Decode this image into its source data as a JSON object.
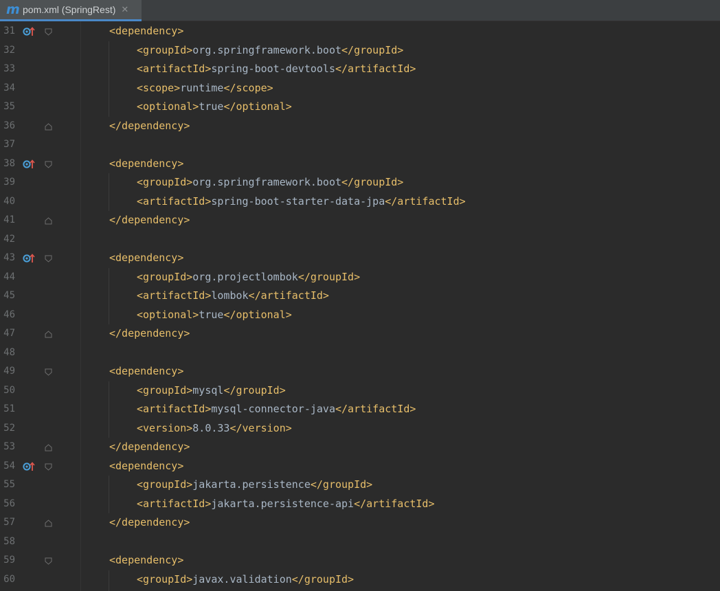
{
  "tab": {
    "icon": "maven-m-icon",
    "icon_glyph": "m",
    "title": "pom.xml (SpringRest)",
    "close_glyph": "✕"
  },
  "lines": [
    {
      "num": "31",
      "indent": 1,
      "open": "<dependency>",
      "content": "",
      "close": "",
      "gutter": true,
      "fold": "start"
    },
    {
      "num": "32",
      "indent": 2,
      "open": "<groupId>",
      "content": "org.springframework.boot",
      "close": "</groupId>"
    },
    {
      "num": "33",
      "indent": 2,
      "open": "<artifactId>",
      "content": "spring-boot-devtools",
      "close": "</artifactId>"
    },
    {
      "num": "34",
      "indent": 2,
      "open": "<scope>",
      "content": "runtime",
      "close": "</scope>"
    },
    {
      "num": "35",
      "indent": 2,
      "open": "<optional>",
      "content": "true",
      "close": "</optional>"
    },
    {
      "num": "36",
      "indent": 1,
      "open": "</dependency>",
      "content": "",
      "close": "",
      "fold": "end"
    },
    {
      "num": "37",
      "indent": 0,
      "open": "",
      "content": "",
      "close": ""
    },
    {
      "num": "38",
      "indent": 1,
      "open": "<dependency>",
      "content": "",
      "close": "",
      "gutter": true,
      "fold": "start"
    },
    {
      "num": "39",
      "indent": 2,
      "open": "<groupId>",
      "content": "org.springframework.boot",
      "close": "</groupId>"
    },
    {
      "num": "40",
      "indent": 2,
      "open": "<artifactId>",
      "content": "spring-boot-starter-data-jpa",
      "close": "</artifactId>"
    },
    {
      "num": "41",
      "indent": 1,
      "open": "</dependency>",
      "content": "",
      "close": "",
      "fold": "end"
    },
    {
      "num": "42",
      "indent": 0,
      "open": "",
      "content": "",
      "close": ""
    },
    {
      "num": "43",
      "indent": 1,
      "open": "<dependency>",
      "content": "",
      "close": "",
      "gutter": true,
      "fold": "start"
    },
    {
      "num": "44",
      "indent": 2,
      "open": "<groupId>",
      "content": "org.projectlombok",
      "close": "</groupId>"
    },
    {
      "num": "45",
      "indent": 2,
      "open": "<artifactId>",
      "content": "lombok",
      "close": "</artifactId>"
    },
    {
      "num": "46",
      "indent": 2,
      "open": "<optional>",
      "content": "true",
      "close": "</optional>"
    },
    {
      "num": "47",
      "indent": 1,
      "open": "</dependency>",
      "content": "",
      "close": "",
      "fold": "end"
    },
    {
      "num": "48",
      "indent": 0,
      "open": "",
      "content": "",
      "close": ""
    },
    {
      "num": "49",
      "indent": 1,
      "open": "<dependency>",
      "content": "",
      "close": "",
      "fold": "start"
    },
    {
      "num": "50",
      "indent": 2,
      "open": "<groupId>",
      "content": "mysql",
      "close": "</groupId>"
    },
    {
      "num": "51",
      "indent": 2,
      "open": "<artifactId>",
      "content": "mysql-connector-java",
      "close": "</artifactId>"
    },
    {
      "num": "52",
      "indent": 2,
      "open": "<version>",
      "content": "8.0.33",
      "close": "</version>"
    },
    {
      "num": "53",
      "indent": 1,
      "open": "</dependency>",
      "content": "",
      "close": "",
      "fold": "end"
    },
    {
      "num": "54",
      "indent": 1,
      "open": "<dependency>",
      "content": "",
      "close": "",
      "gutter": true,
      "fold": "start"
    },
    {
      "num": "55",
      "indent": 2,
      "open": "<groupId>",
      "content": "jakarta.persistence",
      "close": "</groupId>"
    },
    {
      "num": "56",
      "indent": 2,
      "open": "<artifactId>",
      "content": "jakarta.persistence-api",
      "close": "</artifactId>"
    },
    {
      "num": "57",
      "indent": 1,
      "open": "</dependency>",
      "content": "",
      "close": "",
      "fold": "end"
    },
    {
      "num": "58",
      "indent": 0,
      "open": "",
      "content": "",
      "close": ""
    },
    {
      "num": "59",
      "indent": 1,
      "open": "<dependency>",
      "content": "",
      "close": "",
      "fold": "start"
    },
    {
      "num": "60",
      "indent": 2,
      "open": "<groupId>",
      "content": "javax.validation",
      "close": "</groupId>"
    }
  ],
  "colors": {
    "background": "#2b2b2b",
    "tag": "#e8bf6a",
    "text": "#a9b7c6",
    "line_number": "#6d7072",
    "gutter_icon_circle": "#4a9fd8",
    "gutter_icon_arrow": "#e0584f"
  },
  "gutter_icon_name": "overrides-parent-icon",
  "fold_icon_name": "fold-marker-icon"
}
